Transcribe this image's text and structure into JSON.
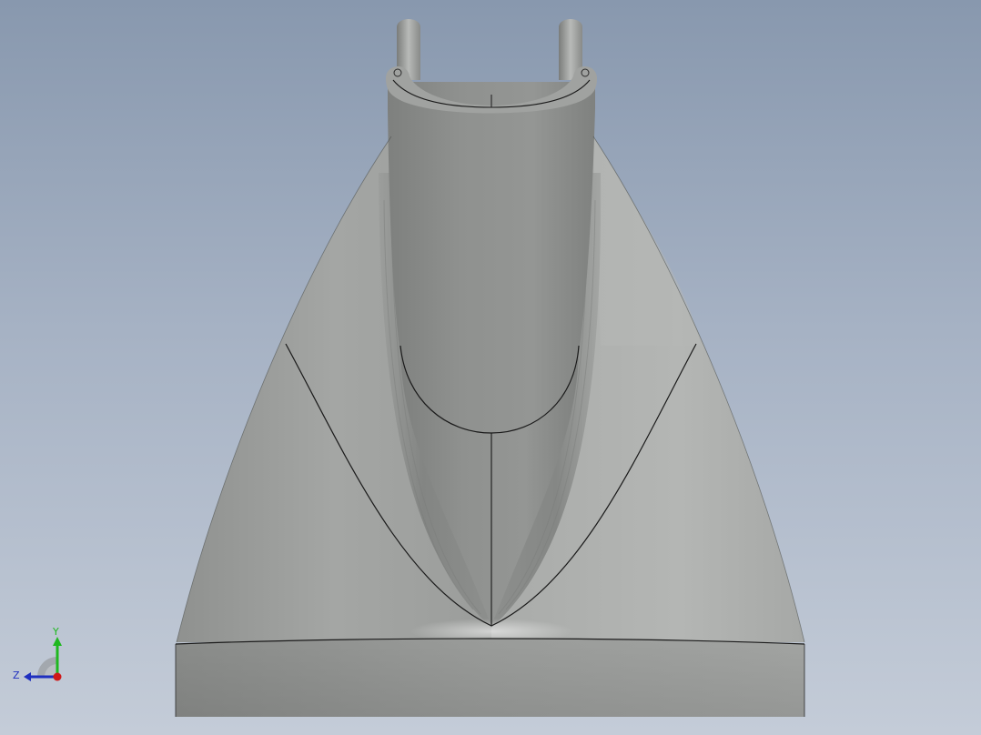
{
  "viewport": {
    "background_top": "#8898ae",
    "background_bottom": "#c4ccd8"
  },
  "model": {
    "description_icon": "cad-part-model",
    "shade_color": "#9a9c9a",
    "edge_color": "#1a1a1a"
  },
  "triad": {
    "y_label": "Y",
    "z_label": "Z",
    "y_color": "#1fb81f",
    "z_color": "#1f2fbf",
    "x_color": "#d01818"
  }
}
